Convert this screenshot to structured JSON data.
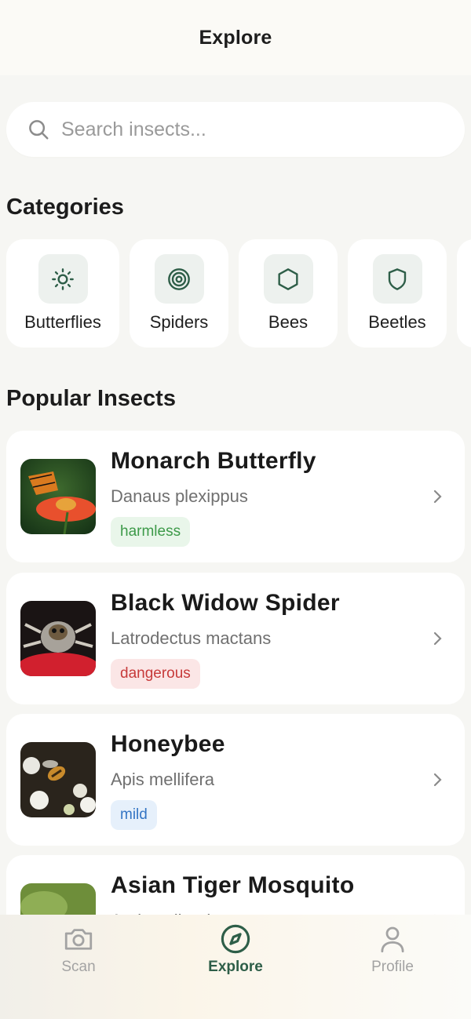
{
  "header": {
    "title": "Explore"
  },
  "search": {
    "placeholder": "Search insects..."
  },
  "categories": {
    "title": "Categories",
    "items": [
      {
        "label": "Butterflies",
        "icon": "sun-icon"
      },
      {
        "label": "Spiders",
        "icon": "target-icon"
      },
      {
        "label": "Bees",
        "icon": "hexagon-icon"
      },
      {
        "label": "Beetles",
        "icon": "shield-icon"
      }
    ]
  },
  "popular": {
    "title": "Popular Insects",
    "items": [
      {
        "name": "Monarch Butterfly",
        "scientific": "Danaus plexippus",
        "badge": "harmless"
      },
      {
        "name": "Black Widow Spider",
        "scientific": "Latrodectus mactans",
        "badge": "dangerous"
      },
      {
        "name": "Honeybee",
        "scientific": "Apis mellifera",
        "badge": "mild"
      },
      {
        "name": "Asian Tiger Mosquito",
        "scientific": "Aedes albopictus",
        "badge": ""
      }
    ]
  },
  "nav": {
    "items": [
      {
        "label": "Scan",
        "icon": "camera-icon",
        "active": false
      },
      {
        "label": "Explore",
        "icon": "compass-icon",
        "active": true
      },
      {
        "label": "Profile",
        "icon": "user-icon",
        "active": false
      }
    ]
  },
  "colors": {
    "accent": "#2e5e48",
    "harmless_text": "#3d9a49",
    "harmless_bg": "#e9f6ea",
    "dangerous_text": "#c73a3a",
    "dangerous_bg": "#fbe6e6",
    "mild_text": "#3475c4",
    "mild_bg": "#e6f0fb"
  }
}
